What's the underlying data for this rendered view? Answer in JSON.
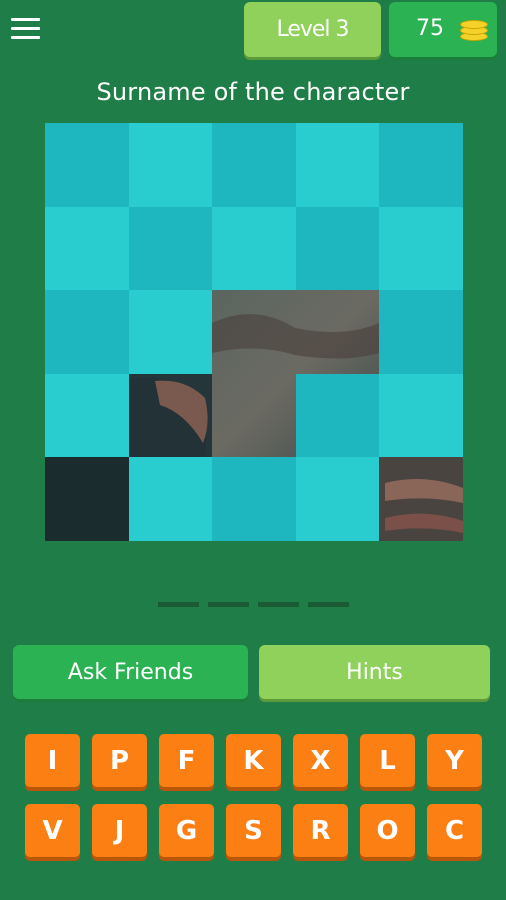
{
  "header": {
    "menu_icon": "hamburger-menu-icon",
    "level_label": "Level 3",
    "coins": "75",
    "coin_icon": "coin-stack-icon"
  },
  "question": {
    "title": "Surname of the character"
  },
  "puzzle": {
    "grid": "5x5",
    "revealed_tiles": [
      [
        2,
        2
      ],
      [
        2,
        3
      ],
      [
        3,
        1
      ],
      [
        3,
        2
      ],
      [
        4,
        0
      ],
      [
        4,
        4
      ]
    ],
    "tile_colors": [
      "#1fb7bf",
      "#29cdd0"
    ]
  },
  "answer": {
    "slots": 4
  },
  "actions": {
    "ask_friends": "Ask Friends",
    "hints": "Hints"
  },
  "keyboard": {
    "row1": [
      "I",
      "P",
      "F",
      "K",
      "X",
      "L",
      "Y"
    ],
    "row2": [
      "V",
      "J",
      "G",
      "S",
      "R",
      "O",
      "C"
    ]
  },
  "colors": {
    "background": "#1f7e47",
    "level_button": "#8fd15b",
    "coins_button": "#2ab253",
    "key": "#fb7f12"
  }
}
